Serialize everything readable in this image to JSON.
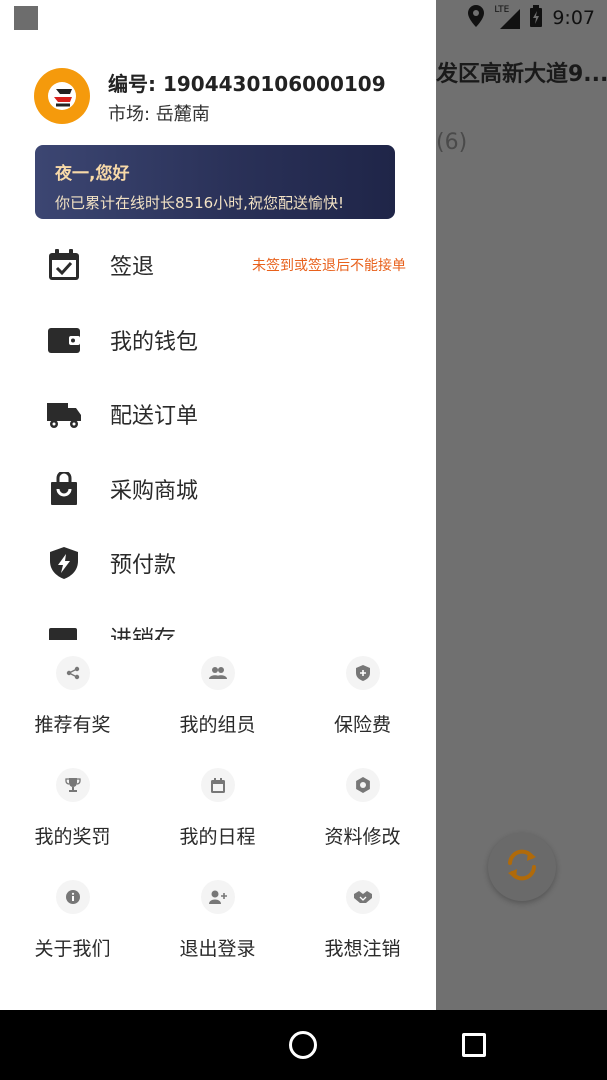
{
  "status_bar": {
    "network": "LTE",
    "time": "9:07"
  },
  "background": {
    "title": "发区高新大道9...",
    "count": "(6)"
  },
  "profile": {
    "id_text": "编号: 1904430106000109",
    "market_text": "市场: 岳麓南"
  },
  "greeting": {
    "title": "夜一,您好",
    "subtitle": "你已累计在线时长8516小时,祝您配送愉快!"
  },
  "menu": [
    {
      "label": "签退",
      "icon": "calendar-check-icon",
      "note": "未签到或签退后不能接单"
    },
    {
      "label": "我的钱包",
      "icon": "wallet-icon"
    },
    {
      "label": "配送订单",
      "icon": "truck-icon"
    },
    {
      "label": "采购商城",
      "icon": "shopping-bag-icon"
    },
    {
      "label": "预付款",
      "icon": "shield-bolt-icon"
    },
    {
      "label": "进销存",
      "icon": "inventory-icon"
    }
  ],
  "grid": [
    {
      "label": "推荐有奖",
      "icon": "share-icon"
    },
    {
      "label": "我的组员",
      "icon": "group-icon"
    },
    {
      "label": "保险费",
      "icon": "shield-plus-icon"
    },
    {
      "label": "我的奖罚",
      "icon": "trophy-icon"
    },
    {
      "label": "我的日程",
      "icon": "calendar-icon"
    },
    {
      "label": "资料修改",
      "icon": "settings-icon"
    },
    {
      "label": "关于我们",
      "icon": "info-icon"
    },
    {
      "label": "退出登录",
      "icon": "user-add-icon"
    },
    {
      "label": "我想注销",
      "icon": "handshake-icon"
    }
  ],
  "colors": {
    "accent": "#f59a0c",
    "note": "#e8611c",
    "card_start": "#3c4672",
    "card_end": "#1f2548"
  }
}
